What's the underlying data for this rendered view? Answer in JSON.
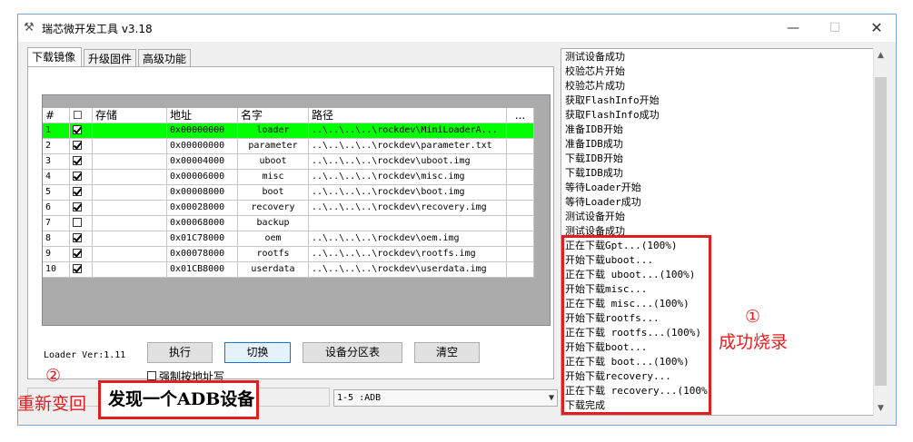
{
  "window": {
    "title": "瑞芯微开发工具 v3.18",
    "minimize": "—",
    "maximize": "☐",
    "close": "✕"
  },
  "tabs": [
    {
      "label": "下载镜像"
    },
    {
      "label": "升级固件"
    },
    {
      "label": "高级功能"
    }
  ],
  "grid": {
    "columns": [
      "#",
      "☐",
      "存储",
      "地址",
      "名字",
      "路径",
      "..."
    ],
    "rows": [
      {
        "no": "1",
        "checked": true,
        "store": "",
        "addr": "0x00000000",
        "name": "loader",
        "path": "..\\..\\..\\..\\rockdev\\MiniLoaderA...",
        "selected": true
      },
      {
        "no": "2",
        "checked": true,
        "store": "",
        "addr": "0x00000000",
        "name": "parameter",
        "path": "..\\..\\..\\..\\rockdev\\parameter.txt"
      },
      {
        "no": "3",
        "checked": true,
        "store": "",
        "addr": "0x00004000",
        "name": "uboot",
        "path": "..\\..\\..\\..\\rockdev\\uboot.img"
      },
      {
        "no": "4",
        "checked": true,
        "store": "",
        "addr": "0x00006000",
        "name": "misc",
        "path": "..\\..\\..\\..\\rockdev\\misc.img"
      },
      {
        "no": "5",
        "checked": true,
        "store": "",
        "addr": "0x00008000",
        "name": "boot",
        "path": "..\\..\\..\\..\\rockdev\\boot.img"
      },
      {
        "no": "6",
        "checked": true,
        "store": "",
        "addr": "0x00028000",
        "name": "recovery",
        "path": "..\\..\\..\\..\\rockdev\\recovery.img"
      },
      {
        "no": "7",
        "checked": false,
        "store": "",
        "addr": "0x00068000",
        "name": "backup",
        "path": ""
      },
      {
        "no": "8",
        "checked": true,
        "store": "",
        "addr": "0x01C78000",
        "name": "oem",
        "path": "..\\..\\..\\..\\rockdev\\oem.img"
      },
      {
        "no": "9",
        "checked": true,
        "store": "",
        "addr": "0x00078000",
        "name": "rootfs",
        "path": "..\\..\\..\\..\\rockdev\\rootfs.img"
      },
      {
        "no": "10",
        "checked": true,
        "store": "",
        "addr": "0x01CB8000",
        "name": "userdata",
        "path": "..\\..\\..\\..\\rockdev\\userdata.img"
      }
    ]
  },
  "loader_ver": "Loader Ver:1.11",
  "buttons": {
    "run": "执行",
    "switch": "切换",
    "partition": "设备分区表",
    "clear": "清空"
  },
  "force_addr": {
    "label": "强制按地址写",
    "checked": false
  },
  "log_lines": [
    "测试设备成功",
    "校验芯片开始",
    "校验芯片成功",
    "获取FlashInfo开始",
    "获取FlashInfo成功",
    "准备IDB开始",
    "准备IDB成功",
    "下载IDB开始",
    "下载IDB成功",
    "等待Loader开始",
    "等待Loader成功",
    "测试设备开始",
    "测试设备成功",
    "正在下载Gpt...(100%)",
    "开始下载uboot...",
    "正在下载 uboot...(100%)",
    "开始下载misc...",
    "正在下载 misc...(100%)",
    "开始下载rootfs...",
    "正在下载 rootfs...(100%)",
    "开始下载boot...",
    "正在下载 boot...(100%)",
    "开始下载recovery...",
    "正在下载 recovery...(100%)",
    "下载完成"
  ],
  "status": {
    "device": "1-5 :ADB",
    "message": "发现一个ADB设备"
  },
  "annotations": {
    "circle1": "①",
    "success": "成功烧录",
    "circle2": "②",
    "change_back": "重新变回"
  },
  "colors": {
    "selected_row": "#00ff00",
    "annotation": "#e02020",
    "focus_border": "#0078d7"
  }
}
